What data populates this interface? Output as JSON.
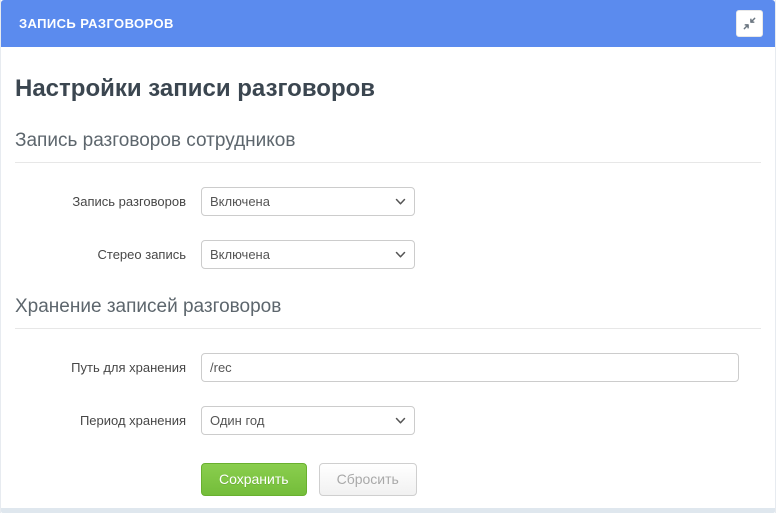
{
  "panel": {
    "header": {
      "title": "ЗАПИСЬ РАЗГОВОРОВ",
      "collapse_icon": "compress-arrows-icon"
    },
    "page_title": "Настройки записи разговоров",
    "sections": [
      {
        "title": "Запись разговоров сотрудников",
        "fields": [
          {
            "label": "Запись разговоров",
            "type": "select",
            "value": "Включена"
          },
          {
            "label": "Стерео запись",
            "type": "select",
            "value": "Включена"
          }
        ]
      },
      {
        "title": "Хранение записей разговоров",
        "fields": [
          {
            "label": "Путь для хранения",
            "type": "text",
            "value": "/rec"
          },
          {
            "label": "Период хранения",
            "type": "select",
            "value": "Один год"
          }
        ]
      }
    ],
    "buttons": {
      "save": "Сохранить",
      "reset": "Сбросить"
    },
    "colors": {
      "header_bg": "#5b8bee",
      "title_text": "#3b4650",
      "section_text": "#5d666d",
      "save_button_green": "#7fc443",
      "reset_button_text": "#a9a9a9",
      "bottom_strip": "#dfe7ee"
    }
  }
}
